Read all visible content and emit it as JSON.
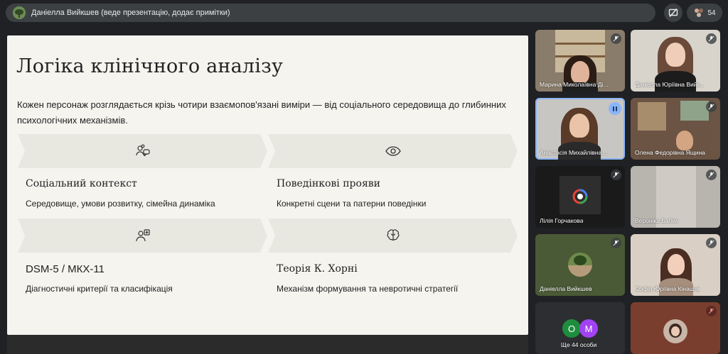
{
  "top_bar": {
    "presenter_text": "Даніелла Вийкшев (веде презентацію, додає примітки)",
    "participants_count": "54"
  },
  "slide": {
    "title": "Логіка клінічного аналізу",
    "description": "Кожен персонаж розглядається крізь чотири взаємопов'язані виміри — від соціального середовища до глибинних психологічних механізмів.",
    "cards": [
      {
        "icon": "people-chat-icon",
        "heading": "Соціальний контекст",
        "text": "Середовище, умови розвитку, сімейна динаміка"
      },
      {
        "icon": "eye-icon",
        "heading": "Поведінкові прояви",
        "text": "Конкретні сцени та патерни поведінки"
      },
      {
        "icon": "clinician-icon",
        "heading": "DSM-5 / МКХ-11",
        "text": "Діагностичні критерії та класифікація"
      },
      {
        "icon": "brain-icon",
        "heading": "Теорія К. Хорні",
        "text": "Механізм формування та невротичні стратегії"
      }
    ]
  },
  "participants": [
    {
      "name": "Марина Миколаївна Ді...",
      "muted": true
    },
    {
      "name": "Даніелла Юріївна Вийк...",
      "muted": true
    },
    {
      "name": "Анастасія Михайлівна ...",
      "speaking": true
    },
    {
      "name": "Олена Федорівна Ящина",
      "muted": true
    },
    {
      "name": "Лілія Горчакова",
      "muted": true
    },
    {
      "name": "Вероніка Бабич",
      "muted": true
    },
    {
      "name": "Даніелла Вийкшев",
      "muted": true
    },
    {
      "name": "Софія Юріївна Кінащук",
      "muted": true
    },
    {
      "name": "",
      "muted": true
    }
  ],
  "overflow_tile": {
    "label": "Ще 44 особи",
    "avatars": [
      {
        "letter": "О",
        "color": "#1e8e3e"
      },
      {
        "letter": "M",
        "color": "#a142f4"
      }
    ]
  },
  "colors": {
    "background": "#202124",
    "slide_background": "#f6f4ef",
    "band": "#e9e8e0",
    "active_speaker": "#8ab4f8"
  }
}
